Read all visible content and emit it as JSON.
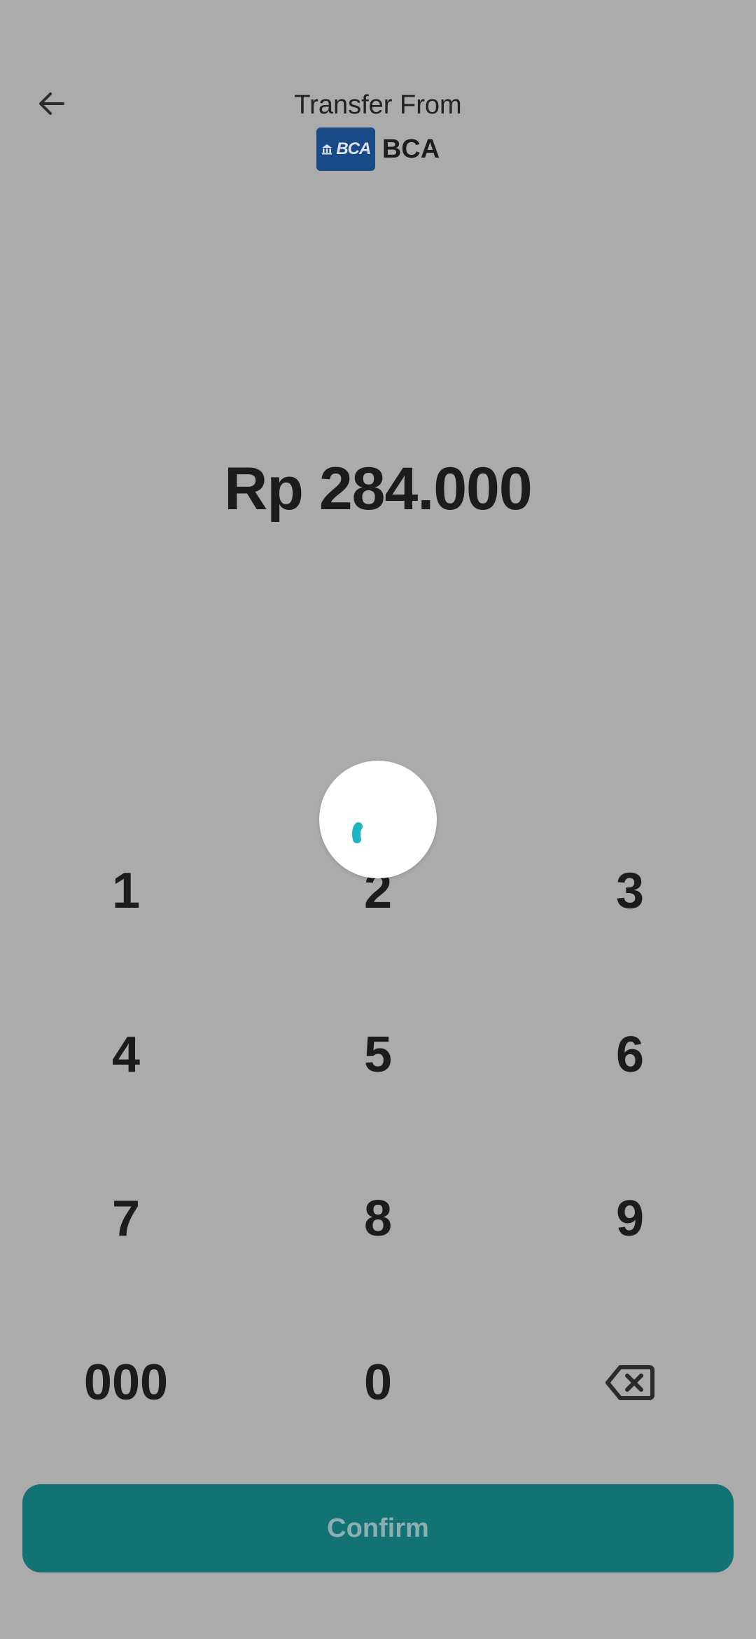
{
  "header": {
    "title": "Transfer From",
    "bank_logo_text": "BCA",
    "bank_name": "BCA"
  },
  "amount": "Rp 284.000",
  "keypad": {
    "keys": [
      "1",
      "2",
      "3",
      "4",
      "5",
      "6",
      "7",
      "8",
      "9",
      "000",
      "0"
    ],
    "backspace_icon": "backspace-icon"
  },
  "confirm_label": "Confirm",
  "colors": {
    "background": "#ababab",
    "accent": "#137374",
    "bank_brand": "#174a86",
    "spinner": "#1bb5bd"
  }
}
